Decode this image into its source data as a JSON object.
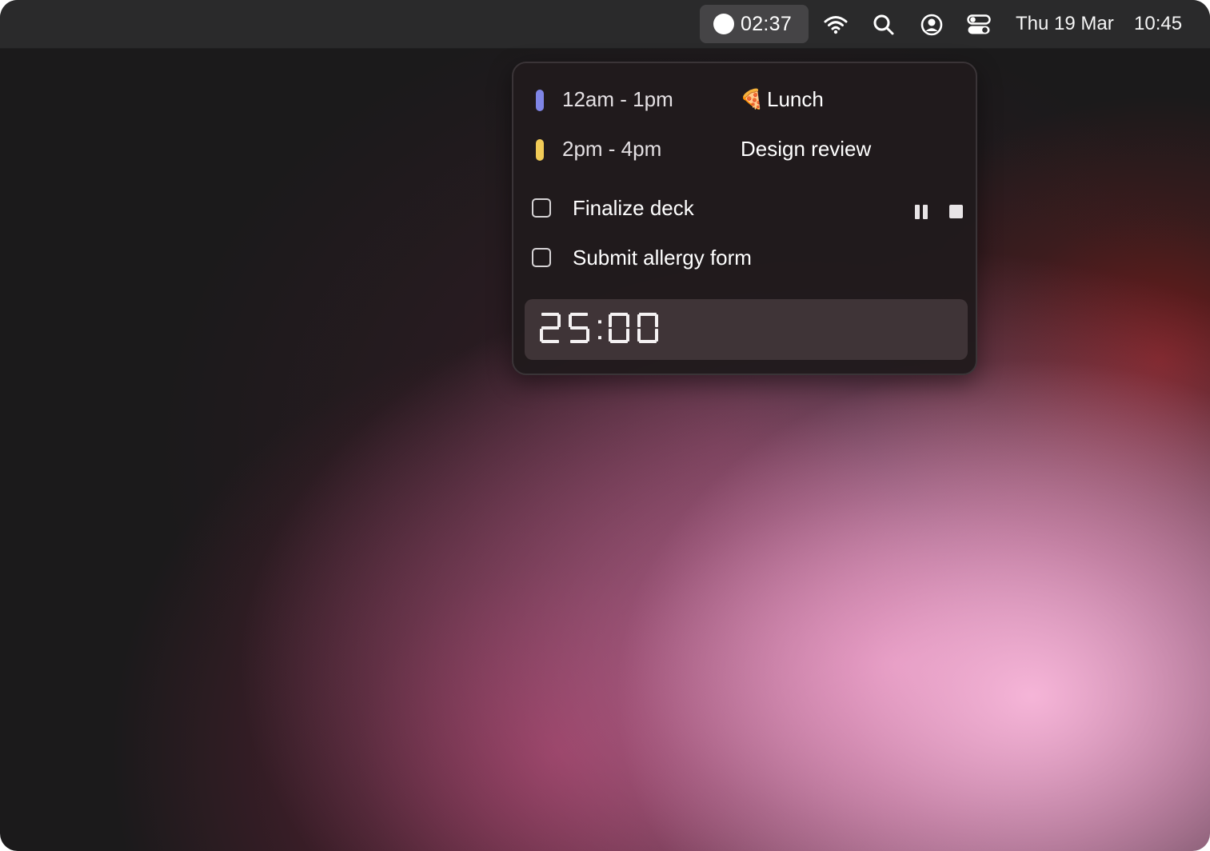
{
  "menubar": {
    "timer": {
      "label": "02:37"
    },
    "icons": [
      "wifi-icon",
      "search-icon",
      "account-icon",
      "control-center-icon"
    ],
    "date": "Thu 19 Mar",
    "clock": "10:45"
  },
  "popover": {
    "events": [
      {
        "time": "12am - 1pm",
        "emoji": "🍕",
        "title": "Lunch",
        "color": "#7f85e6"
      },
      {
        "time": "2pm - 4pm",
        "emoji": "",
        "title": "Design review",
        "color": "#f1cb57"
      }
    ],
    "tasks": [
      {
        "label": "Finalize deck",
        "checked": false
      },
      {
        "label": "Submit allergy form",
        "checked": false
      }
    ],
    "timer_display": "25:00"
  },
  "colors": {
    "menubar_bg": "#2a2a2b",
    "popover_bg": "#201a1c",
    "timer_box_bg": "#3f3437"
  }
}
